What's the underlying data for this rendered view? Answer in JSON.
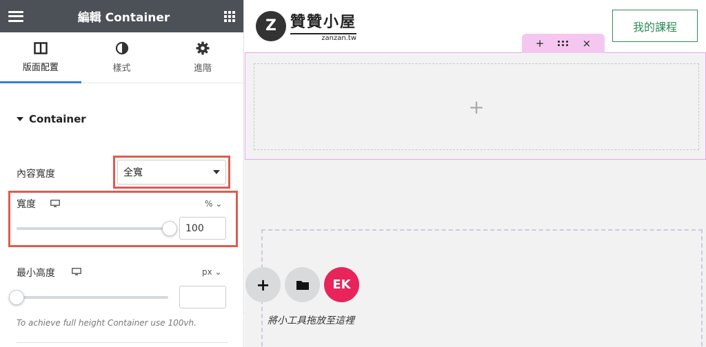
{
  "panel": {
    "title": "編輯 Container",
    "tabs": [
      {
        "label": "版面配置",
        "icon": "layout-icon",
        "active": true
      },
      {
        "label": "樣式",
        "icon": "half-circle-icon",
        "active": false
      },
      {
        "label": "進階",
        "icon": "gear-icon",
        "active": false
      }
    ],
    "section_title": "Container",
    "content_width": {
      "label": "內容寬度",
      "value": "全寬"
    },
    "width": {
      "label": "寬度",
      "unit": "%",
      "value": "100",
      "slider_fraction": 1.0
    },
    "min_height": {
      "label": "最小高度",
      "unit": "px",
      "value": "",
      "slider_fraction": 0.0
    },
    "hint": "To achieve full height Container use 100vh.",
    "collapse_glyph": "‹"
  },
  "canvas": {
    "logo_mark": "Z",
    "logo_name": "贊贊小屋",
    "logo_domain": "zanzan.tw",
    "course_button": "我的課程",
    "toolbar": {
      "add": "+",
      "close": "×"
    },
    "section_add": "+",
    "empty_actions": {
      "add": "+",
      "folder_icon": "folder-icon",
      "brand_label": "EK"
    },
    "drop_hint": "將小工具拖放至這裡"
  },
  "colors": {
    "header_bg": "#4b5157",
    "highlight": "#e05a4f",
    "accent_tab": "#3a7bd5",
    "brand_pink": "#e8245a",
    "course_green": "#2e8b57",
    "container_outline": "#e7a7ea"
  }
}
